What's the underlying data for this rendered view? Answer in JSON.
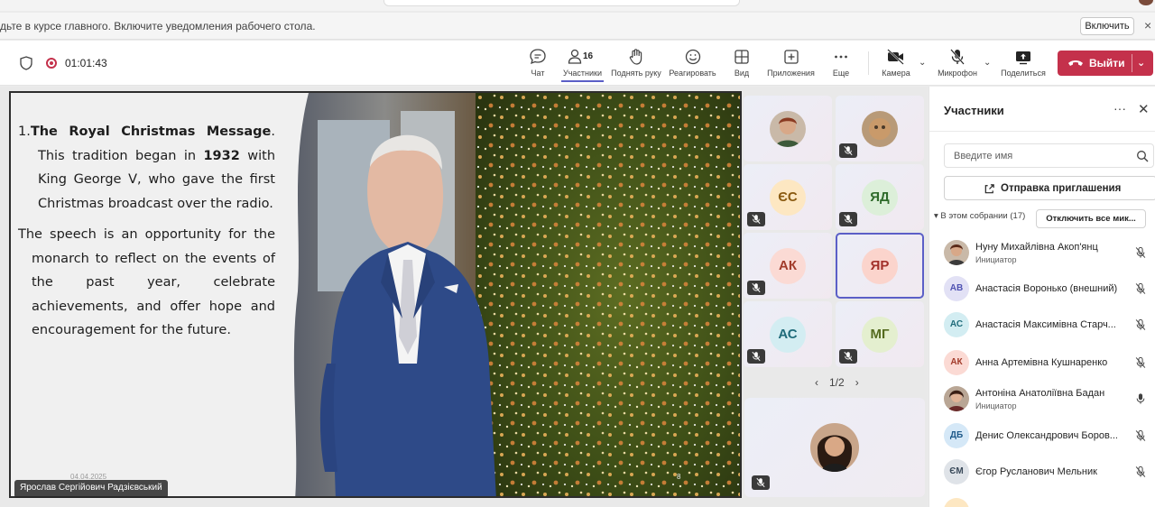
{
  "notice": {
    "text": "дьте в курсе главного. Включите уведомления рабочего стола.",
    "enable_label": "Включить",
    "close": "×"
  },
  "meeting": {
    "timer": "01:01:43"
  },
  "toolbar": {
    "chat": "Чат",
    "participants": "Участники",
    "participants_count": "16",
    "raise_hand": "Поднять руку",
    "react": "Реагировать",
    "view": "Вид",
    "apps": "Приложения",
    "more": "Еще",
    "camera": "Камера",
    "mic": "Микрофон",
    "share": "Поделиться",
    "leave": "Выйти"
  },
  "slide": {
    "p1_num": "1.",
    "p1_bold": "The Royal Christmas Message",
    "p1_a": ". This tradition began in ",
    "p1_year": "1932",
    "p1_b": " with King George V, who gave the first Christmas broadcast over the radio.",
    "p2": "The speech is an opportunity for the monarch to reflect on the events of the past year, celebrate achievements, and offer hope and encouragement for the future.",
    "date": "04.04.2025",
    "page": "8",
    "presenter": "Ярослав Сергійович Радзієвський"
  },
  "grid": {
    "tiles": [
      {
        "initials": "",
        "photo": true
      },
      {
        "initials": "",
        "photo": true
      },
      {
        "initials": "ЄС"
      },
      {
        "initials": "ЯД"
      },
      {
        "initials": "АК"
      },
      {
        "initials": "ЯР"
      },
      {
        "initials": "АС"
      },
      {
        "initials": "МГ"
      }
    ],
    "pager": "1/2",
    "prev": "‹",
    "next": "›"
  },
  "panel": {
    "title": "Участники",
    "search_placeholder": "Введите имя",
    "invite_label": "Отправка приглашения",
    "section": "▾ В этом собрании (17)",
    "mute_all": "Отключить все мик...",
    "people": [
      {
        "name": "Нуну Михайлівна Акоп'янц",
        "role": "Инициатор",
        "initials": ""
      },
      {
        "name": "Анастасія Воронько (внешний)",
        "role": "",
        "initials": "АВ"
      },
      {
        "name": "Анастасія Максимівна Старч...",
        "role": "",
        "initials": "АС"
      },
      {
        "name": "Анна Артемівна Кушнаренко",
        "role": "",
        "initials": "АК"
      },
      {
        "name": "Антоніна Анатоліївна Бадан",
        "role": "Инициатор",
        "initials": ""
      },
      {
        "name": "Денис Олександрович Боров...",
        "role": "",
        "initials": "ДБ"
      },
      {
        "name": "Єгор Русланович Мельник",
        "role": "",
        "initials": "ЄМ"
      }
    ]
  },
  "colors": {
    "accent": "#5b5fc7",
    "leave": "#c4314b"
  }
}
